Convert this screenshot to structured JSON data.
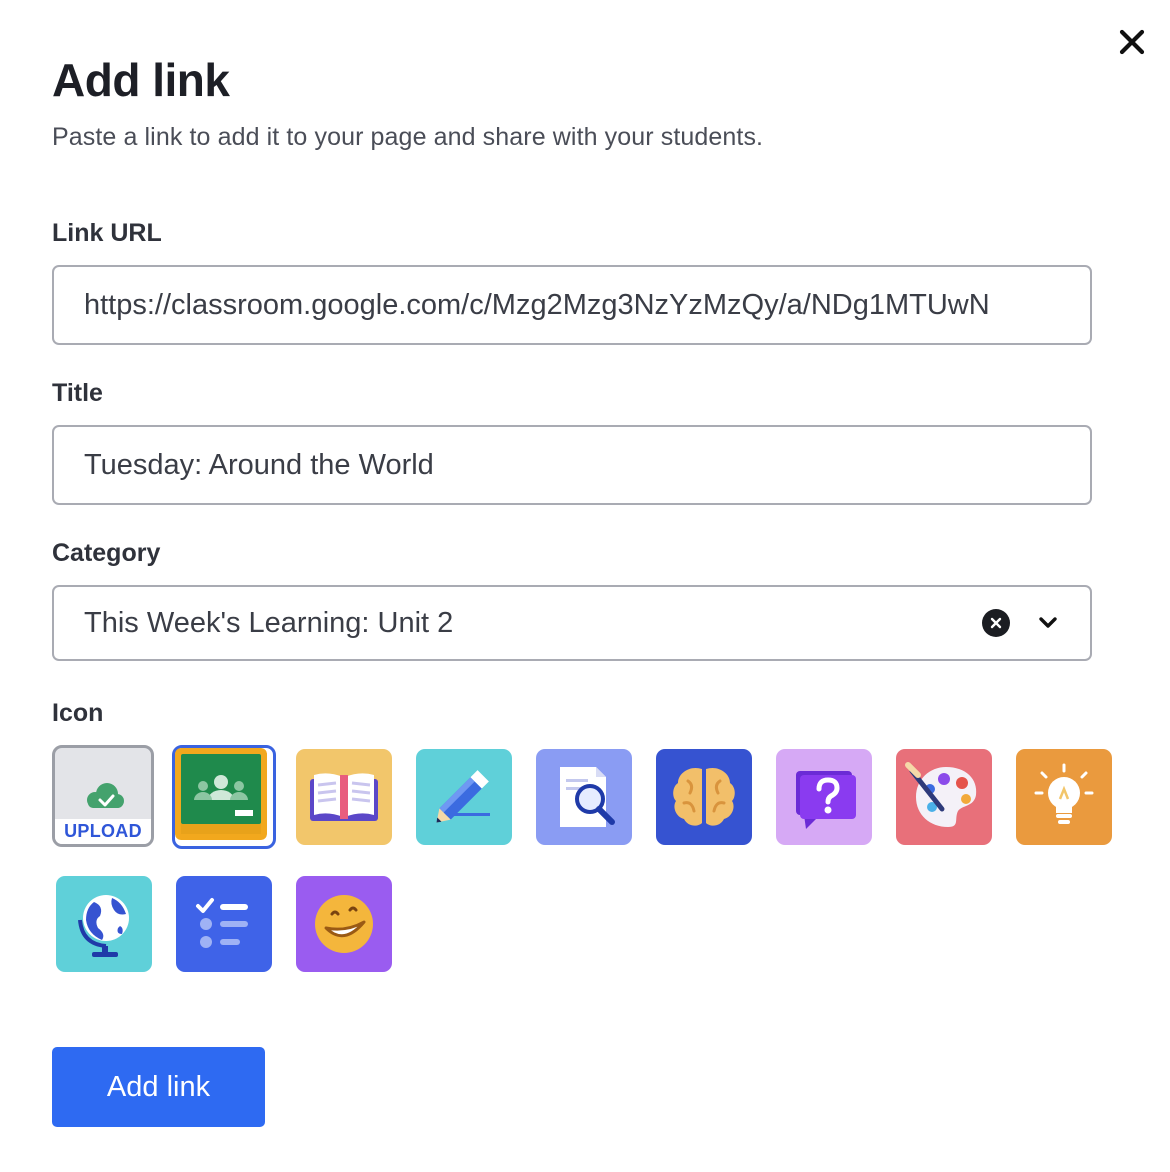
{
  "dialog": {
    "title": "Add link",
    "subtitle": "Paste a link to add it to your page and share with your students.",
    "close_icon": "close-icon"
  },
  "form": {
    "url": {
      "label": "Link URL",
      "value": "https://classroom.google.com/c/Mzg2Mzg3NzYzMzQy/a/NDg1MTUwN"
    },
    "title": {
      "label": "Title",
      "value": "Tuesday: Around the World"
    },
    "category": {
      "label": "Category",
      "value": "This Week's Learning: Unit 2"
    },
    "icon": {
      "label": "Icon",
      "upload_label": "UPLOAD",
      "selected": "google-classroom",
      "options": [
        "upload",
        "google-classroom",
        "book",
        "pencil",
        "document-search",
        "brain",
        "question-chat",
        "paint-palette",
        "lightbulb",
        "globe",
        "checklist",
        "smiley"
      ]
    }
  },
  "actions": {
    "submit_label": "Add link"
  },
  "colors": {
    "primary": "#2e6af2",
    "selected_border": "#3a63e0",
    "border": "#a9abb3"
  }
}
